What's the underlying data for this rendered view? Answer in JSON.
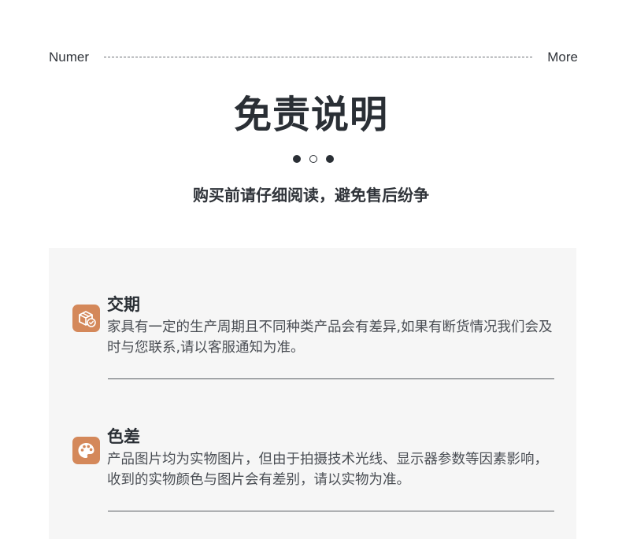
{
  "header": {
    "left_label": "Numer",
    "right_label": "More"
  },
  "main": {
    "title": "免责说明",
    "subtitle": "购买前请仔细阅读，避免售后纷争"
  },
  "items": [
    {
      "title": "交期",
      "icon": "delivery-box-icon",
      "description": "家具有一定的生产周期且不同种类产品会有差异,如果有断货情况我们会及时与您联系,请以客服通知为准。"
    },
    {
      "title": "色差",
      "icon": "palette-icon",
      "description": "产品图片均为实物图片，但由于拍摄技术光线、显示器参数等因素影响，收到的实物颜色与图片会有差别，请以实物为准。"
    }
  ],
  "colors": {
    "accent": "#d4885a",
    "text": "#2f3339",
    "panel_bg": "#f6f6f6"
  }
}
